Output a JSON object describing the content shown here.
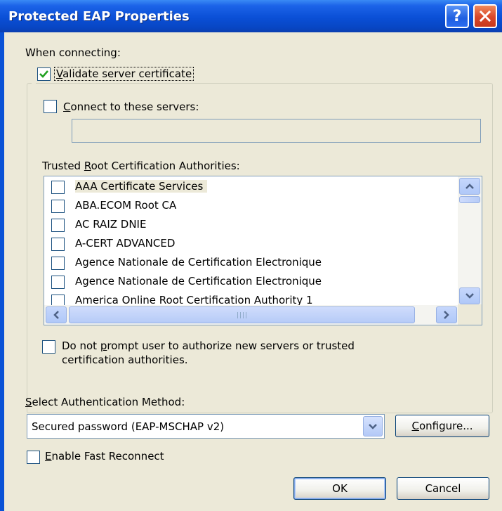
{
  "window": {
    "title": "Protected EAP Properties",
    "help_glyph": "?",
    "close_glyph": "✕"
  },
  "connecting": {
    "label": "When connecting:",
    "validate_cert": {
      "mnemonic": "V",
      "rest": "alidate server certificate",
      "checked": true
    },
    "connect_servers": {
      "mnemonic": "C",
      "rest": "onnect to these servers:",
      "checked": false,
      "value": ""
    },
    "trusted_root": {
      "pre": "Trusted ",
      "mnemonic": "R",
      "post": "oot Certification Authorities:"
    },
    "authorities": [
      {
        "label": "AAA Certificate Services",
        "checked": false,
        "selected": true
      },
      {
        "label": "ABA.ECOM Root CA",
        "checked": false
      },
      {
        "label": "AC RAIZ DNIE",
        "checked": false
      },
      {
        "label": "A-CERT ADVANCED",
        "checked": false
      },
      {
        "label": "Agence Nationale de Certification Electronique",
        "checked": false
      },
      {
        "label": "Agence Nationale de Certification Electronique",
        "checked": false
      },
      {
        "label": "America Online Root Certification Authority 1",
        "checked": false
      }
    ],
    "no_prompt": {
      "pre": "Do not ",
      "mnemonic": "p",
      "line1_post": "rompt user to authorize new servers or trusted",
      "line2": "certification authorities.",
      "checked": false
    }
  },
  "auth": {
    "label_mnemonic": "S",
    "label_rest": "elect Authentication Method:",
    "selected_method": "Secured password (EAP-MSCHAP v2)",
    "configure_mnemonic": "C",
    "configure_rest": "onfigure..."
  },
  "fast_reconnect": {
    "mnemonic": "E",
    "rest": "nable Fast Reconnect",
    "checked": false
  },
  "buttons": {
    "ok": "OK",
    "cancel": "Cancel"
  },
  "colors": {
    "title_blue": "#0a4fd6",
    "dialog_bg": "#ece9d8",
    "close_red": "#d8462a",
    "check_green": "#21a121"
  }
}
